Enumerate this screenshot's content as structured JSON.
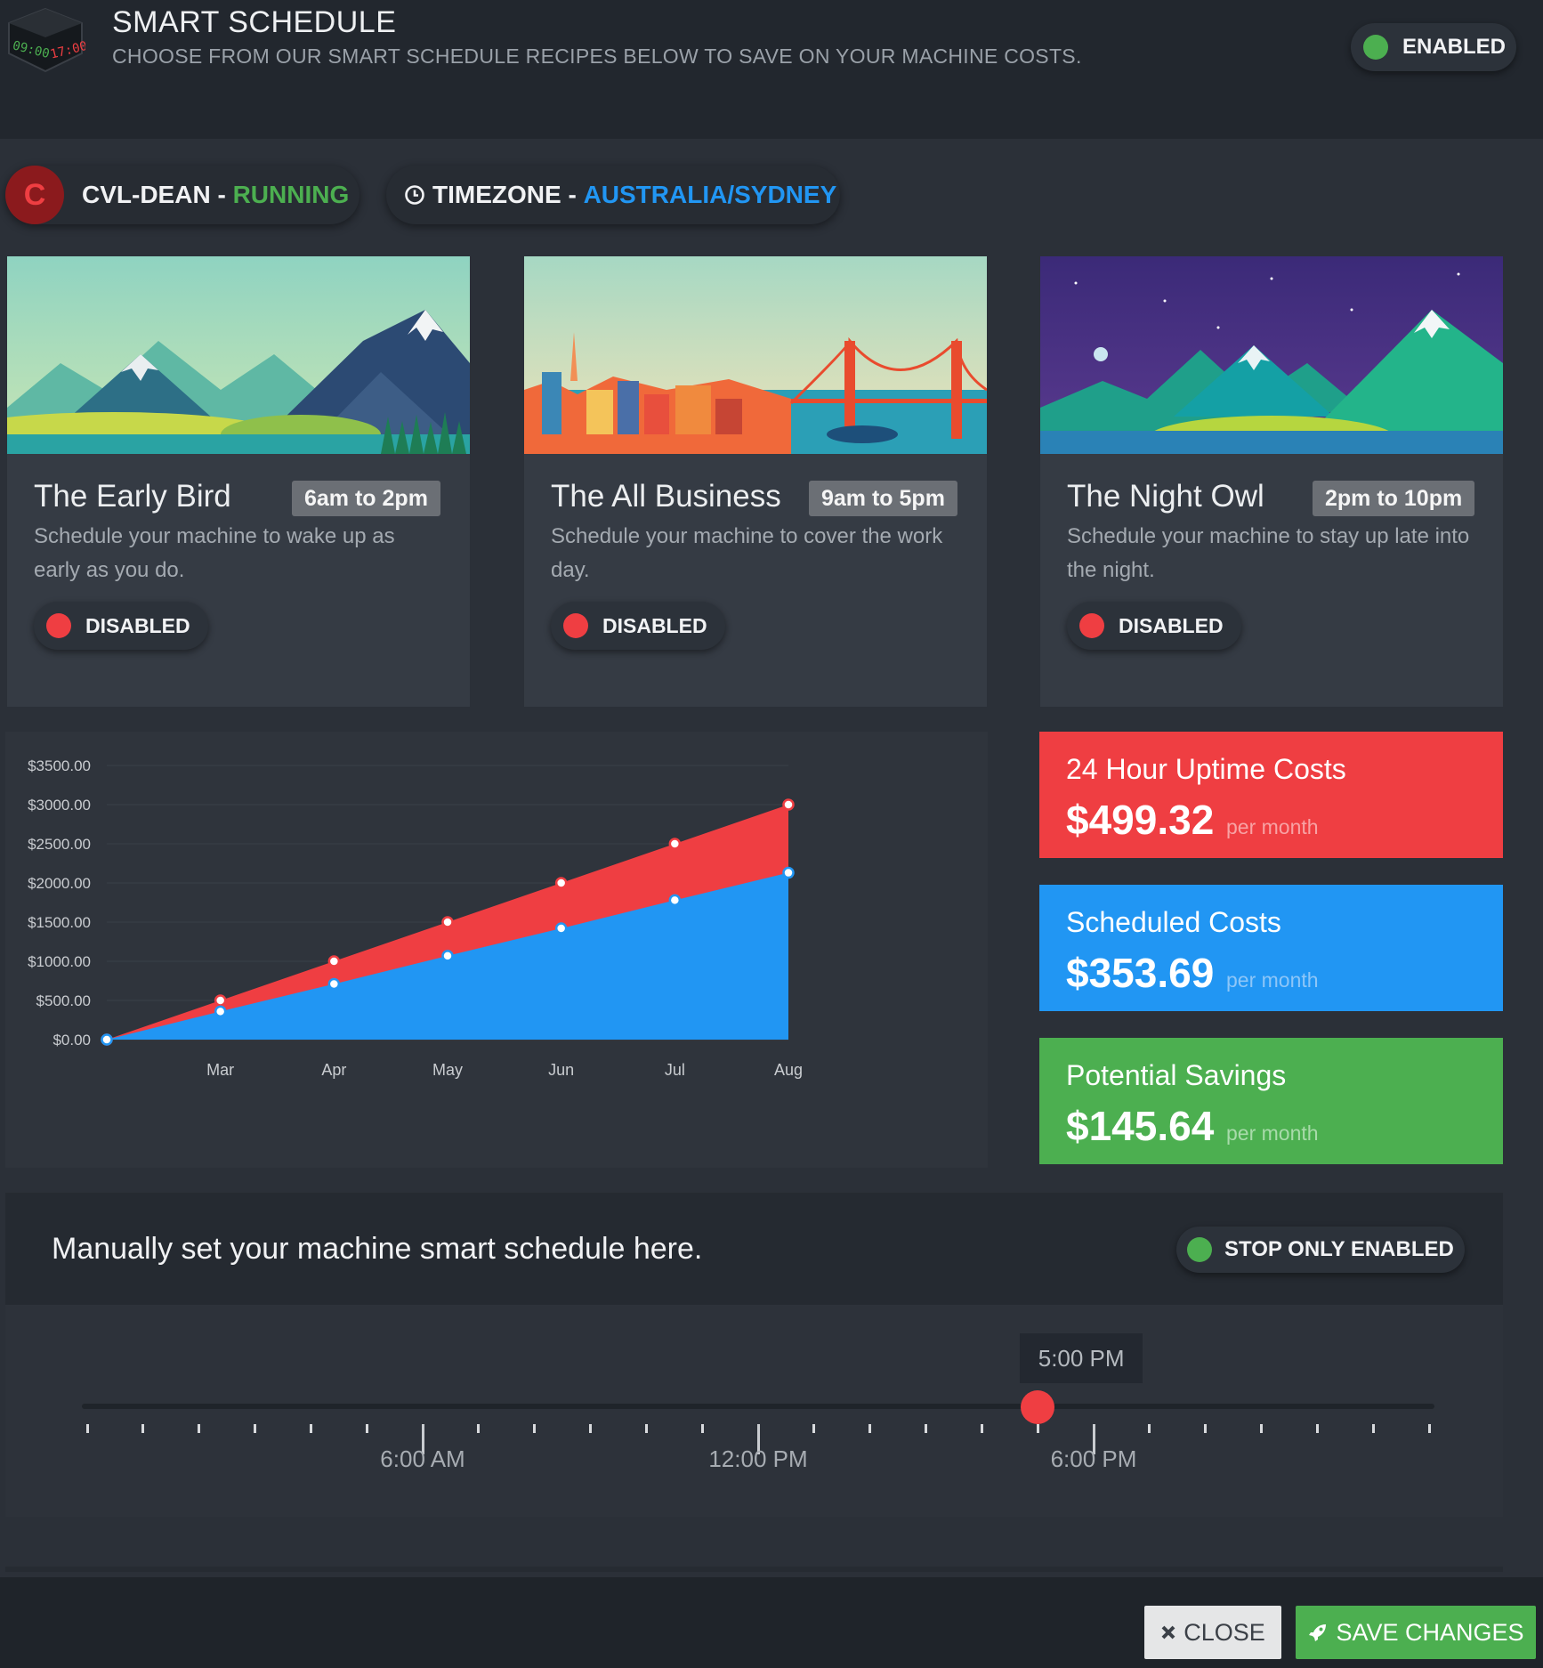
{
  "header": {
    "title": "SMART SCHEDULE",
    "subtitle": "CHOOSE FROM OUR SMART SCHEDULE RECIPES BELOW TO SAVE ON YOUR MACHINE COSTS.",
    "logo_times": [
      "09:00",
      "17:00"
    ],
    "status_label": "ENABLED"
  },
  "machine": {
    "avatar_letter": "C",
    "name": "CVL-DEAN",
    "separator": " - ",
    "status": "RUNNING"
  },
  "timezone": {
    "label": "TIMEZONE",
    "separator": " - ",
    "value": "AUSTRALIA/SYDNEY"
  },
  "recipes": [
    {
      "title": "The Early Bird",
      "time": "6am to 2pm",
      "description": "Schedule your machine to wake up as early as you do.",
      "status": "DISABLED",
      "image": "mountains-day-illustration"
    },
    {
      "title": "The All Business",
      "time": "9am to 5pm",
      "description": "Schedule your machine to cover the work day.",
      "status": "DISABLED",
      "image": "city-bridge-illustration"
    },
    {
      "title": "The Night Owl",
      "time": "2pm to 10pm",
      "description": "Schedule your machine to stay up late into the night.",
      "status": "DISABLED",
      "image": "mountains-night-illustration"
    }
  ],
  "chart_data": {
    "type": "area",
    "x": [
      "",
      "Mar",
      "Apr",
      "May",
      "Jun",
      "Jul",
      "Aug"
    ],
    "y_ticks": [
      "$0.00",
      "$500.00",
      "$1000.00",
      "$1500.00",
      "$2000.00",
      "$2500.00",
      "$3000.00",
      "$3500.00"
    ],
    "ylim": [
      0,
      3500
    ],
    "grid": true,
    "series": [
      {
        "values": [
          0,
          500,
          1000,
          1500,
          2000,
          2500,
          3000
        ],
        "color": "#ef3e42"
      },
      {
        "values": [
          0,
          360,
          710,
          1070,
          1420,
          1780,
          2130
        ],
        "color": "#2196f3"
      }
    ]
  },
  "costs": [
    {
      "label": "24 Hour Uptime Costs",
      "value": "$499.32",
      "unit": "per month",
      "color": "#ef3e42"
    },
    {
      "label": "Scheduled Costs",
      "value": "$353.69",
      "unit": "per month",
      "color": "#2196f3"
    },
    {
      "label": "Potential Savings",
      "value": "$145.64",
      "unit": "per month",
      "color": "#4caf50"
    }
  ],
  "manual": {
    "title": "Manually set your machine smart schedule here.",
    "status_label": "STOP ONLY ENABLED",
    "slider": {
      "value_label": "5:00 PM",
      "value_hours": 17,
      "range_hours": [
        0,
        24
      ],
      "labels": [
        "6:00 AM",
        "12:00 PM",
        "6:00 PM"
      ]
    }
  },
  "footer": {
    "close_label": "CLOSE",
    "save_label": "SAVE CHANGES"
  }
}
